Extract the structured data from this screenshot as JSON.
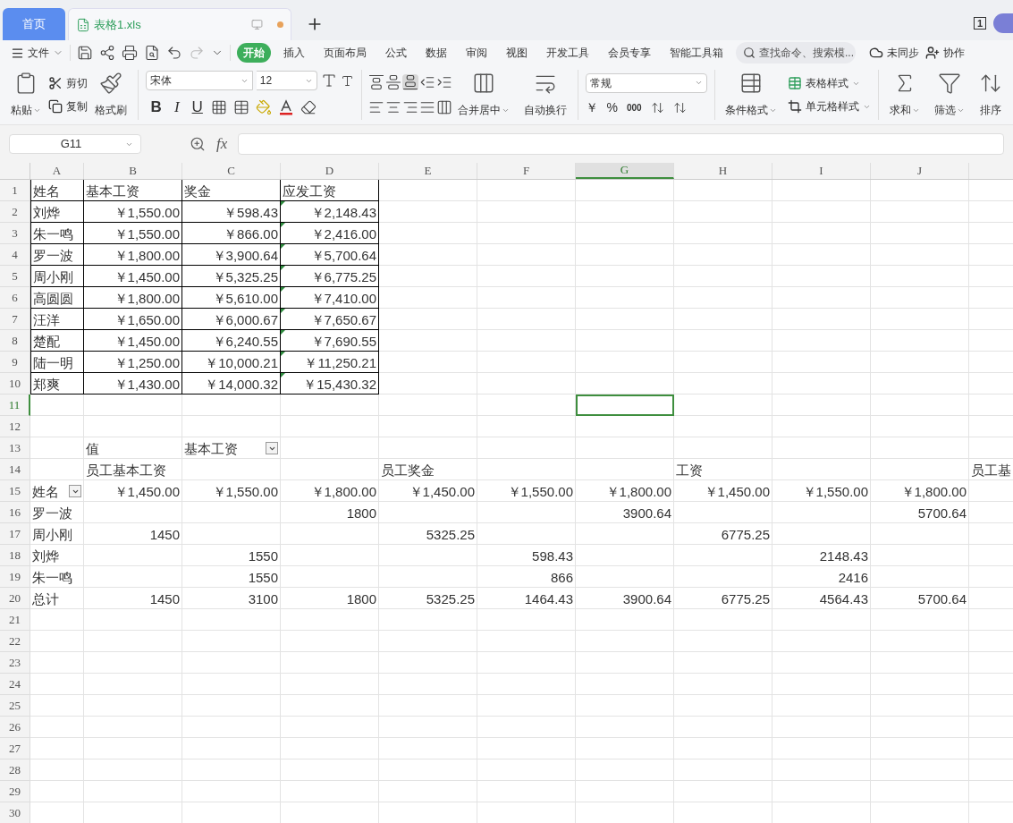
{
  "tabs": [
    {
      "kind": "home",
      "label": "首页",
      "selected": false
    },
    {
      "kind": "doc",
      "label": "表格1.xls",
      "selected": true,
      "unsaved": true
    }
  ],
  "window_count": "1",
  "menu": {
    "file": "文件",
    "items": [
      {
        "label": "开始",
        "selected": true
      },
      {
        "label": "插入",
        "selected": false
      },
      {
        "label": "页面布局",
        "selected": false
      },
      {
        "label": "公式",
        "selected": false
      },
      {
        "label": "数据",
        "selected": false
      },
      {
        "label": "审阅",
        "selected": false
      },
      {
        "label": "视图",
        "selected": false
      },
      {
        "label": "开发工具",
        "selected": false
      },
      {
        "label": "会员专享",
        "selected": false
      },
      {
        "label": "智能工具箱",
        "selected": false
      }
    ],
    "search": {
      "placeholder": "查找命令、搜索模..."
    },
    "sync": "未同步",
    "collab": "协作"
  },
  "ribbon": {
    "paste": "粘贴",
    "cut": "剪切",
    "copy": "复制",
    "format_painter": "格式刷",
    "font": "宋体",
    "size": "12",
    "bold": "B",
    "italic": "I",
    "underline": "U",
    "merge": "合并居中",
    "wrap": "自动换行",
    "number_format": "常规",
    "currency": "￥",
    "percent": "%",
    "thousands": "000",
    "cond_format": "条件格式",
    "table_style": "表格样式",
    "cell_style": "单元格样式",
    "sum": "求和",
    "filter": "筛选",
    "sort": "排序"
  },
  "formula_bar": {
    "name_box": "G11",
    "fx": "fx"
  },
  "columns": [
    {
      "label": "A",
      "selected": false
    },
    {
      "label": "B",
      "selected": false
    },
    {
      "label": "C",
      "selected": false
    },
    {
      "label": "D",
      "selected": false
    },
    {
      "label": "E",
      "selected": false
    },
    {
      "label": "F",
      "selected": false
    },
    {
      "label": "G",
      "selected": true
    },
    {
      "label": "H",
      "selected": false
    },
    {
      "label": "I",
      "selected": false
    },
    {
      "label": "J",
      "selected": false
    }
  ],
  "rows": [
    {
      "number": "1",
      "selected": false,
      "cells": [
        {
          "text": "姓名",
          "boxed": true
        },
        {
          "text": "基本工资",
          "boxed": true
        },
        {
          "text": "奖金",
          "boxed": true
        },
        {
          "text": "应发工资",
          "boxed": true
        },
        null,
        null,
        null,
        null,
        null,
        null,
        null
      ]
    },
    {
      "number": "2",
      "selected": false,
      "cells": [
        {
          "text": "刘烨",
          "boxed": true
        },
        {
          "text": "￥1,550.00",
          "boxed": true,
          "right_aligned": true
        },
        {
          "text": "￥598.43",
          "boxed": true,
          "right_aligned": true
        },
        {
          "text": "￥2,148.43",
          "boxed": true,
          "right_aligned": true,
          "flag": true
        },
        null,
        null,
        null,
        null,
        null,
        null,
        null
      ]
    },
    {
      "number": "3",
      "selected": false,
      "cells": [
        {
          "text": "朱一鸣",
          "boxed": true
        },
        {
          "text": "￥1,550.00",
          "boxed": true,
          "right_aligned": true
        },
        {
          "text": "￥866.00",
          "boxed": true,
          "right_aligned": true
        },
        {
          "text": "￥2,416.00",
          "boxed": true,
          "right_aligned": true,
          "flag": true
        },
        null,
        null,
        null,
        null,
        null,
        null,
        null
      ]
    },
    {
      "number": "4",
      "selected": false,
      "cells": [
        {
          "text": "罗一波",
          "boxed": true
        },
        {
          "text": "￥1,800.00",
          "boxed": true,
          "right_aligned": true
        },
        {
          "text": "￥3,900.64",
          "boxed": true,
          "right_aligned": true
        },
        {
          "text": "￥5,700.64",
          "boxed": true,
          "right_aligned": true,
          "flag": true
        },
        null,
        null,
        null,
        null,
        null,
        null,
        null
      ]
    },
    {
      "number": "5",
      "selected": false,
      "cells": [
        {
          "text": "周小刚",
          "boxed": true
        },
        {
          "text": "￥1,450.00",
          "boxed": true,
          "right_aligned": true
        },
        {
          "text": "￥5,325.25",
          "boxed": true,
          "right_aligned": true
        },
        {
          "text": "￥6,775.25",
          "boxed": true,
          "right_aligned": true,
          "flag": true
        },
        null,
        null,
        null,
        null,
        null,
        null,
        null
      ]
    },
    {
      "number": "6",
      "selected": false,
      "cells": [
        {
          "text": "高圆圆",
          "boxed": true
        },
        {
          "text": "￥1,800.00",
          "boxed": true,
          "right_aligned": true
        },
        {
          "text": "￥5,610.00",
          "boxed": true,
          "right_aligned": true
        },
        {
          "text": "￥7,410.00",
          "boxed": true,
          "right_aligned": true,
          "flag": true
        },
        null,
        null,
        null,
        null,
        null,
        null,
        null
      ]
    },
    {
      "number": "7",
      "selected": false,
      "cells": [
        {
          "text": "汪洋",
          "boxed": true
        },
        {
          "text": "￥1,650.00",
          "boxed": true,
          "right_aligned": true
        },
        {
          "text": "￥6,000.67",
          "boxed": true,
          "right_aligned": true
        },
        {
          "text": "￥7,650.67",
          "boxed": true,
          "right_aligned": true,
          "flag": true
        },
        null,
        null,
        null,
        null,
        null,
        null,
        null
      ]
    },
    {
      "number": "8",
      "selected": false,
      "cells": [
        {
          "text": "楚配",
          "boxed": true
        },
        {
          "text": "￥1,450.00",
          "boxed": true,
          "right_aligned": true
        },
        {
          "text": "￥6,240.55",
          "boxed": true,
          "right_aligned": true
        },
        {
          "text": "￥7,690.55",
          "boxed": true,
          "right_aligned": true,
          "flag": true
        },
        null,
        null,
        null,
        null,
        null,
        null,
        null
      ]
    },
    {
      "number": "9",
      "selected": false,
      "cells": [
        {
          "text": "陆一明",
          "boxed": true
        },
        {
          "text": "￥1,250.00",
          "boxed": true,
          "right_aligned": true
        },
        {
          "text": "￥10,000.21",
          "boxed": true,
          "right_aligned": true
        },
        {
          "text": "￥11,250.21",
          "boxed": true,
          "right_aligned": true,
          "flag": true
        },
        null,
        null,
        null,
        null,
        null,
        null,
        null
      ]
    },
    {
      "number": "10",
      "selected": false,
      "cells": [
        {
          "text": "郑爽",
          "boxed": true
        },
        {
          "text": "￥1,430.00",
          "boxed": true,
          "right_aligned": true
        },
        {
          "text": "￥14,000.32",
          "boxed": true,
          "right_aligned": true
        },
        {
          "text": "￥15,430.32",
          "boxed": true,
          "right_aligned": true,
          "flag": true
        },
        null,
        null,
        null,
        null,
        null,
        null,
        null
      ]
    },
    {
      "number": "11",
      "selected": true,
      "cells": [
        null,
        null,
        null,
        null,
        null,
        null,
        {
          "selected": true
        },
        null,
        null,
        null,
        null
      ]
    },
    {
      "number": "12",
      "selected": false,
      "cells": [
        null,
        null,
        null,
        null,
        null,
        null,
        null,
        null,
        null,
        null,
        null
      ]
    },
    {
      "number": "13",
      "selected": false,
      "cells": [
        null,
        {
          "text": "值"
        },
        {
          "text": "基本工资",
          "dropdown": true
        },
        null,
        null,
        null,
        null,
        null,
        null,
        null,
        null
      ]
    },
    {
      "number": "14",
      "selected": false,
      "cells": [
        null,
        {
          "text": "员工基本工资"
        },
        null,
        null,
        {
          "text": "员工奖金"
        },
        null,
        null,
        {
          "text": "工资"
        },
        null,
        null,
        {
          "text": "员工基"
        }
      ]
    },
    {
      "number": "15",
      "selected": false,
      "cells": [
        {
          "text": "姓名",
          "dropdown": true
        },
        {
          "text": "￥1,450.00",
          "right_aligned": true
        },
        {
          "text": "￥1,550.00",
          "right_aligned": true
        },
        {
          "text": "￥1,800.00",
          "right_aligned": true
        },
        {
          "text": "￥1,450.00",
          "right_aligned": true
        },
        {
          "text": "￥1,550.00",
          "right_aligned": true
        },
        {
          "text": "￥1,800.00",
          "right_aligned": true
        },
        {
          "text": "￥1,450.00",
          "right_aligned": true
        },
        {
          "text": "￥1,550.00",
          "right_aligned": true
        },
        {
          "text": "￥1,800.00",
          "right_aligned": true
        },
        null
      ]
    },
    {
      "number": "16",
      "selected": false,
      "cells": [
        {
          "text": "罗一波"
        },
        null,
        null,
        {
          "text": "1800",
          "right_aligned": true
        },
        null,
        null,
        {
          "text": "3900.64",
          "right_aligned": true
        },
        null,
        null,
        {
          "text": "5700.64",
          "right_aligned": true
        },
        null
      ]
    },
    {
      "number": "17",
      "selected": false,
      "cells": [
        {
          "text": "周小刚"
        },
        {
          "text": "1450",
          "right_aligned": true
        },
        null,
        null,
        {
          "text": "5325.25",
          "right_aligned": true
        },
        null,
        null,
        {
          "text": "6775.25",
          "right_aligned": true
        },
        null,
        null,
        null
      ]
    },
    {
      "number": "18",
      "selected": false,
      "cells": [
        {
          "text": "刘烨"
        },
        null,
        {
          "text": "1550",
          "right_aligned": true
        },
        null,
        null,
        {
          "text": "598.43",
          "right_aligned": true
        },
        null,
        null,
        {
          "text": "2148.43",
          "right_aligned": true
        },
        null,
        null
      ]
    },
    {
      "number": "19",
      "selected": false,
      "cells": [
        {
          "text": "朱一鸣"
        },
        null,
        {
          "text": "1550",
          "right_aligned": true
        },
        null,
        null,
        {
          "text": "866",
          "right_aligned": true
        },
        null,
        null,
        {
          "text": "2416",
          "right_aligned": true
        },
        null,
        null
      ]
    },
    {
      "number": "20",
      "selected": false,
      "cells": [
        {
          "text": "总计"
        },
        {
          "text": "1450",
          "right_aligned": true
        },
        {
          "text": "3100",
          "right_aligned": true
        },
        {
          "text": "1800",
          "right_aligned": true
        },
        {
          "text": "5325.25",
          "right_aligned": true
        },
        {
          "text": "1464.43",
          "right_aligned": true
        },
        {
          "text": "3900.64",
          "right_aligned": true
        },
        {
          "text": "6775.25",
          "right_aligned": true
        },
        {
          "text": "4564.43",
          "right_aligned": true
        },
        {
          "text": "5700.64",
          "right_aligned": true
        },
        null
      ]
    },
    {
      "number": "21",
      "selected": false,
      "cells": [
        null,
        null,
        null,
        null,
        null,
        null,
        null,
        null,
        null,
        null,
        null
      ]
    },
    {
      "number": "22",
      "selected": false,
      "cells": [
        null,
        null,
        null,
        null,
        null,
        null,
        null,
        null,
        null,
        null,
        null
      ]
    },
    {
      "number": "23",
      "selected": false,
      "cells": [
        null,
        null,
        null,
        null,
        null,
        null,
        null,
        null,
        null,
        null,
        null
      ]
    },
    {
      "number": "24",
      "selected": false,
      "cells": [
        null,
        null,
        null,
        null,
        null,
        null,
        null,
        null,
        null,
        null,
        null
      ]
    },
    {
      "number": "25",
      "selected": false,
      "cells": [
        null,
        null,
        null,
        null,
        null,
        null,
        null,
        null,
        null,
        null,
        null
      ]
    },
    {
      "number": "26",
      "selected": false,
      "cells": [
        null,
        null,
        null,
        null,
        null,
        null,
        null,
        null,
        null,
        null,
        null
      ]
    },
    {
      "number": "27",
      "selected": false,
      "cells": [
        null,
        null,
        null,
        null,
        null,
        null,
        null,
        null,
        null,
        null,
        null
      ]
    },
    {
      "number": "28",
      "selected": false,
      "cells": [
        null,
        null,
        null,
        null,
        null,
        null,
        null,
        null,
        null,
        null,
        null
      ]
    },
    {
      "number": "29",
      "selected": false,
      "cells": [
        null,
        null,
        null,
        null,
        null,
        null,
        null,
        null,
        null,
        null,
        null
      ]
    },
    {
      "number": "30",
      "selected": false,
      "cells": [
        null,
        null,
        null,
        null,
        null,
        null,
        null,
        null,
        null,
        null,
        null
      ]
    }
  ]
}
